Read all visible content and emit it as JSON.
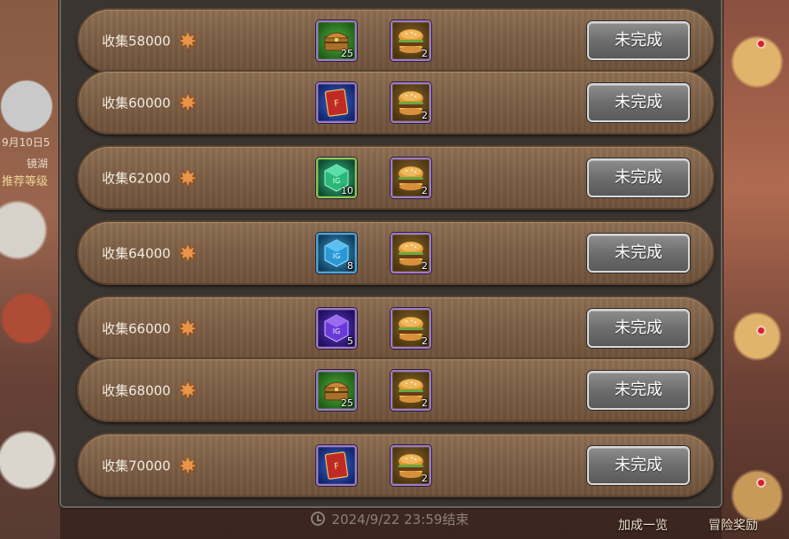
{
  "background": {
    "left_texts": [
      "9月10日5",
      "镜湖",
      "推荐等级"
    ],
    "menu": [
      "加成一览",
      "冒险奖励"
    ]
  },
  "timer": {
    "text": "2024/9/22  23:59结束",
    "icon": "clock-icon"
  },
  "leaf_icon": "maple-leaf-icon",
  "rows": [
    {
      "label": "收集58000",
      "item1": {
        "icon": "treasure-chest-icon",
        "count": "25"
      },
      "item2": {
        "icon": "burger-icon",
        "count": "2"
      },
      "button": "未完成"
    },
    {
      "label": "收集60000",
      "item1": {
        "icon": "red-ticket-icon",
        "count": ""
      },
      "item2": {
        "icon": "burger-icon",
        "count": "2"
      },
      "button": "未完成"
    },
    {
      "label": "收集62000",
      "item1": {
        "icon": "green-cube-icon",
        "count": "10"
      },
      "item2": {
        "icon": "burger-icon",
        "count": "2"
      },
      "button": "未完成"
    },
    {
      "label": "收集64000",
      "item1": {
        "icon": "blue-cube-icon",
        "count": "8"
      },
      "item2": {
        "icon": "burger-icon",
        "count": "2"
      },
      "button": "未完成"
    },
    {
      "label": "收集66000",
      "item1": {
        "icon": "purple-cube-icon",
        "count": "5"
      },
      "item2": {
        "icon": "burger-icon",
        "count": "2"
      },
      "button": "未完成"
    },
    {
      "label": "收集68000",
      "item1": {
        "icon": "treasure-chest-icon",
        "count": "25"
      },
      "item2": {
        "icon": "burger-icon",
        "count": "2"
      },
      "button": "未完成"
    },
    {
      "label": "收集70000",
      "item1": {
        "icon": "red-ticket-icon",
        "count": ""
      },
      "item2": {
        "icon": "burger-icon",
        "count": "2"
      },
      "button": "未完成"
    }
  ],
  "colors": {
    "row_wood": "#7c5e45",
    "button_gray": "#6e6e6e",
    "leaf_orange": "#e8954a",
    "notification_red": "#d8202a"
  }
}
